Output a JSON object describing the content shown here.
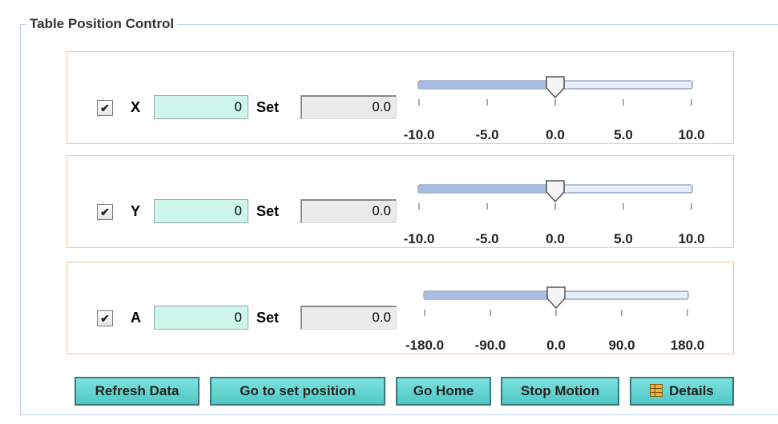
{
  "panel": {
    "title": "Table Position Control"
  },
  "axes": [
    {
      "label": "X",
      "enabled_mark": "✔",
      "value": "0",
      "set_label": "Set",
      "set_value": "0.0",
      "slider": {
        "min": -10.0,
        "max": 10.0,
        "value": 0.0,
        "tick_labels": [
          "-10.0",
          "-5.0",
          "0.0",
          "5.0",
          "10.0"
        ]
      }
    },
    {
      "label": "Y",
      "enabled_mark": "✔",
      "value": "0",
      "set_label": "Set",
      "set_value": "0.0",
      "slider": {
        "min": -10.0,
        "max": 10.0,
        "value": 0.0,
        "tick_labels": [
          "-10.0",
          "-5.0",
          "0.0",
          "5.0",
          "10.0"
        ]
      }
    },
    {
      "label": "A",
      "enabled_mark": "✔",
      "value": "0",
      "set_label": "Set",
      "set_value": "0.0",
      "slider": {
        "min": -180.0,
        "max": 180.0,
        "value": 0.0,
        "tick_labels": [
          "-180.0",
          "-90.0",
          "0.0",
          "90.0",
          "180.0"
        ]
      }
    }
  ],
  "buttons": {
    "refresh": "Refresh Data",
    "goto_set": "Go to set position",
    "go_home": "Go Home",
    "stop": "Stop Motion",
    "details": "Details"
  },
  "icons": {
    "details": "table-icon",
    "checkbox": "checkmark-icon"
  },
  "colors": {
    "value_field_bg": "#ccf7ea",
    "panel_border": "#f3c79f",
    "button_bg": "#4ec8c4"
  }
}
